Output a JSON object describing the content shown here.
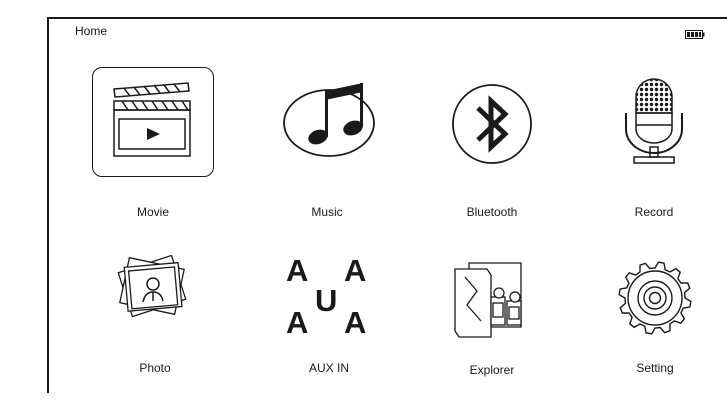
{
  "header": {
    "title": "Home",
    "battery_icon": "battery-full-icon"
  },
  "menu": {
    "selected_item": "Movie",
    "items": [
      {
        "id": "movie",
        "label": "Movie",
        "icon": "clapperboard-icon"
      },
      {
        "id": "music",
        "label": "Music",
        "icon": "music-notes-icon"
      },
      {
        "id": "bluetooth",
        "label": "Bluetooth",
        "icon": "bluetooth-icon"
      },
      {
        "id": "record",
        "label": "Record",
        "icon": "microphone-icon"
      },
      {
        "id": "photo",
        "label": "Photo",
        "icon": "photo-stack-icon"
      },
      {
        "id": "aux",
        "label": "AUX IN",
        "icon": "aux-letters-icon",
        "glyphs": [
          "A",
          "A",
          "U",
          "A",
          "A"
        ]
      },
      {
        "id": "explorer",
        "label": "Explorer",
        "icon": "folder-explorer-icon"
      },
      {
        "id": "setting",
        "label": "Setting",
        "icon": "gear-icon"
      }
    ]
  },
  "colors": {
    "ink": "#1a1a1a",
    "background": "#ffffff"
  }
}
